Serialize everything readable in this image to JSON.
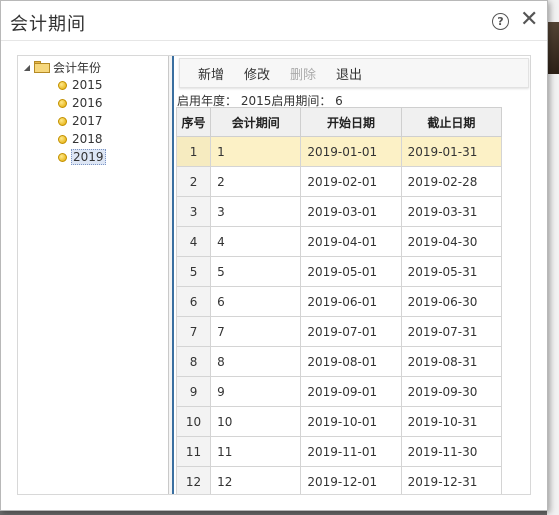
{
  "window": {
    "title": "会计期间"
  },
  "tree": {
    "root_label": "会计年份",
    "years": [
      "2015",
      "2016",
      "2017",
      "2018",
      "2019"
    ],
    "selected_year": "2019"
  },
  "toolbar": {
    "add_label": "新增",
    "edit_label": "修改",
    "delete_label": "删除",
    "exit_label": "退出"
  },
  "info": {
    "text": "启用年度： 2015启用期间： 6"
  },
  "table": {
    "columns": [
      "序号",
      "会计期间",
      "开始日期",
      "截止日期"
    ],
    "selected_row": 0,
    "rows": [
      [
        "1",
        "1",
        "2019-01-01",
        "2019-01-31"
      ],
      [
        "2",
        "2",
        "2019-02-01",
        "2019-02-28"
      ],
      [
        "3",
        "3",
        "2019-03-01",
        "2019-03-31"
      ],
      [
        "4",
        "4",
        "2019-04-01",
        "2019-04-30"
      ],
      [
        "5",
        "5",
        "2019-05-01",
        "2019-05-31"
      ],
      [
        "6",
        "6",
        "2019-06-01",
        "2019-06-30"
      ],
      [
        "7",
        "7",
        "2019-07-01",
        "2019-07-31"
      ],
      [
        "8",
        "8",
        "2019-08-01",
        "2019-08-31"
      ],
      [
        "9",
        "9",
        "2019-09-01",
        "2019-09-30"
      ],
      [
        "10",
        "10",
        "2019-10-01",
        "2019-10-31"
      ],
      [
        "11",
        "11",
        "2019-11-01",
        "2019-11-30"
      ],
      [
        "12",
        "12",
        "2019-12-01",
        "2019-12-31"
      ]
    ]
  }
}
